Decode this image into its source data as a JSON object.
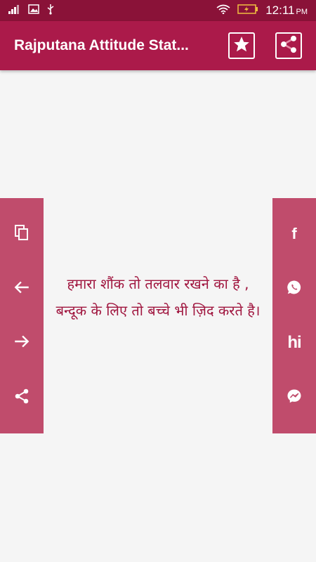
{
  "status_bar": {
    "time": "12:11",
    "ampm": "PM",
    "icons": [
      "signal-icon",
      "image-icon",
      "usb-icon",
      "wifi-icon",
      "battery-icon"
    ]
  },
  "app_bar": {
    "title": "Rajputana Attitude Stat...",
    "actions": [
      "star-icon",
      "share-icon"
    ]
  },
  "left_bar": {
    "buttons": [
      "copy-icon",
      "arrow-left-icon",
      "arrow-right-icon",
      "share-icon"
    ]
  },
  "right_bar": {
    "buttons": [
      "facebook-icon",
      "whatsapp-icon",
      "hike-icon",
      "messenger-icon"
    ],
    "facebook_label": "f",
    "hike_label": "hi"
  },
  "quote": {
    "text": "हमारा शौंक तो तलवार रखने का है , बन्दूक के लिए तो बच्चे भी ज़िद करते है।"
  },
  "colors": {
    "status_bar": "#8a1238",
    "app_bar": "#ab1a4a",
    "side_bar": "#c04c6c",
    "quote_text": "#a0163f",
    "background": "#f5f5f5"
  }
}
